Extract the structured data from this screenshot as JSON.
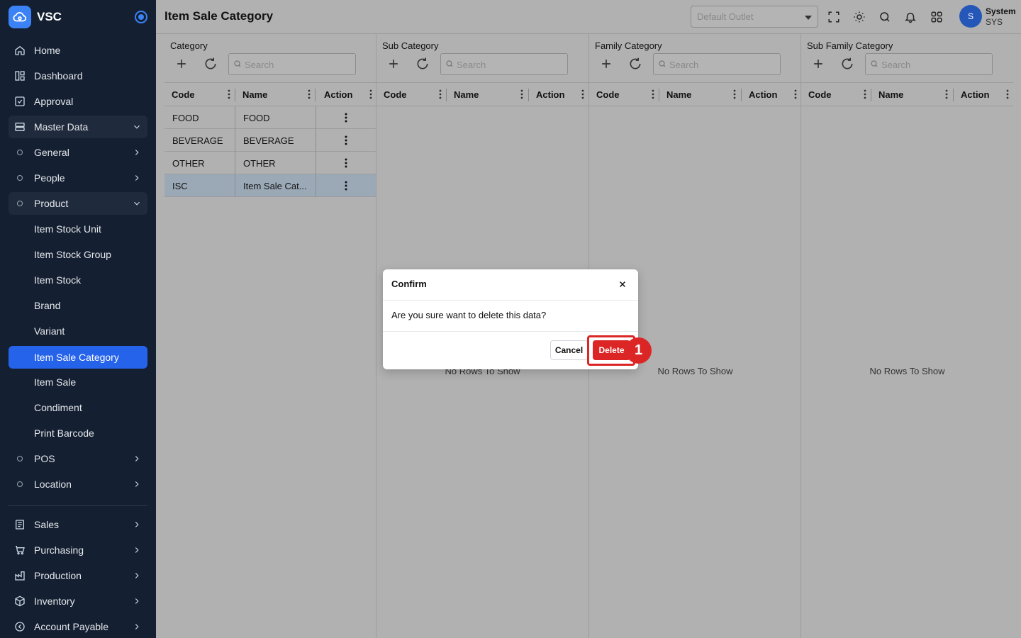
{
  "app": {
    "name": "VSC"
  },
  "sidebar": {
    "items": [
      {
        "label": "Home",
        "icon": "home-icon"
      },
      {
        "label": "Dashboard",
        "icon": "dashboard-icon"
      },
      {
        "label": "Approval",
        "icon": "approval-icon"
      },
      {
        "label": "Master Data",
        "icon": "master-data-icon"
      },
      {
        "label": "General"
      },
      {
        "label": "People"
      },
      {
        "label": "Product"
      },
      {
        "label": "Item Stock Unit"
      },
      {
        "label": "Item Stock Group"
      },
      {
        "label": "Item Stock"
      },
      {
        "label": "Brand"
      },
      {
        "label": "Variant"
      },
      {
        "label": "Item Sale Category"
      },
      {
        "label": "Item Sale"
      },
      {
        "label": "Condiment"
      },
      {
        "label": "Print Barcode"
      },
      {
        "label": "POS"
      },
      {
        "label": "Location"
      },
      {
        "label": "Sales",
        "icon": "sales-icon"
      },
      {
        "label": "Purchasing",
        "icon": "cart-icon"
      },
      {
        "label": "Production",
        "icon": "production-icon"
      },
      {
        "label": "Inventory",
        "icon": "box-icon"
      },
      {
        "label": "Account Payable",
        "icon": "account-payable-icon"
      }
    ]
  },
  "header": {
    "title": "Item Sale Category",
    "outlet_placeholder": "Default Outlet",
    "user": {
      "initial": "S",
      "name": "System",
      "code": "SYS"
    }
  },
  "panels": [
    {
      "title": "Category",
      "search_placeholder": "Search",
      "columns": [
        "Code",
        "Name",
        "Action"
      ],
      "rows": [
        {
          "code": "FOOD",
          "name": "FOOD"
        },
        {
          "code": "BEVERAGE",
          "name": "BEVERAGE"
        },
        {
          "code": "OTHER",
          "name": "OTHER"
        },
        {
          "code": "ISC",
          "name": "Item Sale Cat..."
        }
      ]
    },
    {
      "title": "Sub Category",
      "search_placeholder": "Search",
      "columns": [
        "Code",
        "Name",
        "Action"
      ],
      "empty_text": "No Rows To Show"
    },
    {
      "title": "Family Category",
      "search_placeholder": "Search",
      "columns": [
        "Code",
        "Name",
        "Action"
      ],
      "empty_text": "No Rows To Show"
    },
    {
      "title": "Sub Family Category",
      "search_placeholder": "Search",
      "columns": [
        "Code",
        "Name",
        "Action"
      ],
      "empty_text": "No Rows To Show"
    }
  ],
  "modal": {
    "title": "Confirm",
    "message": "Are you sure want to delete this data?",
    "cancel_label": "Cancel",
    "delete_label": "Delete"
  },
  "annotation": {
    "step": "1"
  },
  "colors": {
    "sidebar_bg": "#142032",
    "accent": "#2563eb",
    "danger": "#dc2626",
    "overlay": "#b1b1b1"
  }
}
